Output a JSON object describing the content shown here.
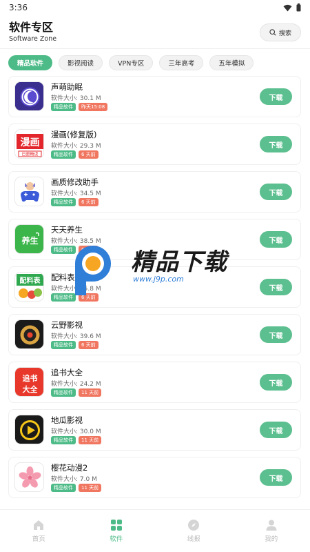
{
  "status_bar": {
    "time": "3:36"
  },
  "header": {
    "title": "软件专区",
    "subtitle": "Software Zone",
    "search_label": "搜索"
  },
  "tabs": [
    "精品软件",
    "影视阅读",
    "VPN专区",
    "三年高考",
    "五年模拟"
  ],
  "size_prefix": "软件大小:",
  "download_label": "下载",
  "apps": [
    {
      "name": "声萌助眠",
      "size": "30.1 M",
      "tag": "精品软件",
      "time": "昨天15:08",
      "icon": "moon-icon"
    },
    {
      "name": "漫画(修复版)",
      "size": "29.3 M",
      "tag": "精品软件",
      "time": "6 天前",
      "icon": "manhua-icon"
    },
    {
      "name": "画质修改助手",
      "size": "34.5 M",
      "tag": "精品软件",
      "time": "6 天前",
      "icon": "gamepad-icon"
    },
    {
      "name": "天天养生",
      "size": "38.5 M",
      "tag": "精品软件",
      "time": "6 天前",
      "icon": "yangsheng-icon"
    },
    {
      "name": "配料表",
      "size": "35.8 M",
      "tag": "精品软件",
      "time": "6 天前",
      "icon": "peiliao-icon"
    },
    {
      "name": "云野影视",
      "size": "39.6 M",
      "tag": "精品软件",
      "time": "6 天前",
      "icon": "record-icon"
    },
    {
      "name": "追书大全",
      "size": "24.2 M",
      "tag": "精品软件",
      "time": "11 天前",
      "icon": "zhuishu-icon"
    },
    {
      "name": "地瓜影视",
      "size": "30.0 M",
      "tag": "精品软件",
      "time": "11 天前",
      "icon": "play-icon"
    },
    {
      "name": "樱花动漫2",
      "size": "7.0 M",
      "tag": "精品软件",
      "time": "11 天前",
      "icon": "sakura-icon"
    }
  ],
  "watermark": {
    "text": "精品下载",
    "url": "www.j9p.com"
  },
  "bottom_nav": [
    {
      "label": "首页",
      "icon": "home-icon"
    },
    {
      "label": "软件",
      "icon": "grid-icon"
    },
    {
      "label": "线报",
      "icon": "compass-icon"
    },
    {
      "label": "我的",
      "icon": "user-icon"
    }
  ],
  "colors": {
    "accent": "#4dbb87",
    "badge_red": "#f07660",
    "download": "#5cbf8f"
  }
}
